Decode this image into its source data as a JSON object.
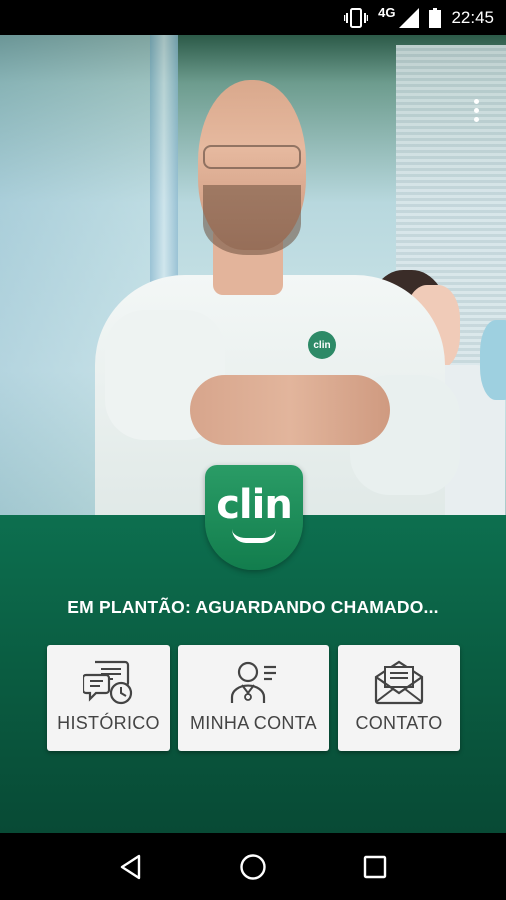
{
  "status_bar": {
    "network": "4G",
    "time": "22:45",
    "icons": [
      "vibrate-icon",
      "signal-icon",
      "battery-icon"
    ]
  },
  "app": {
    "logo_text": "clin",
    "status_message": "EM PLANTÃO: AGUARDANDO CHAMADO...",
    "colors": {
      "primary_green": "#0a5c41",
      "logo_green": "#1e8a58",
      "button_bg": "#f4f4f4",
      "button_text": "#444444"
    }
  },
  "menu": {
    "buttons": [
      {
        "label": "HISTÓRICO",
        "icon": "history-icon"
      },
      {
        "label": "MINHA CONTA",
        "icon": "account-icon"
      },
      {
        "label": "CONTATO",
        "icon": "contact-mail-icon"
      }
    ]
  },
  "nav_bar": {
    "buttons": [
      "back-icon",
      "home-icon",
      "recents-icon"
    ]
  }
}
